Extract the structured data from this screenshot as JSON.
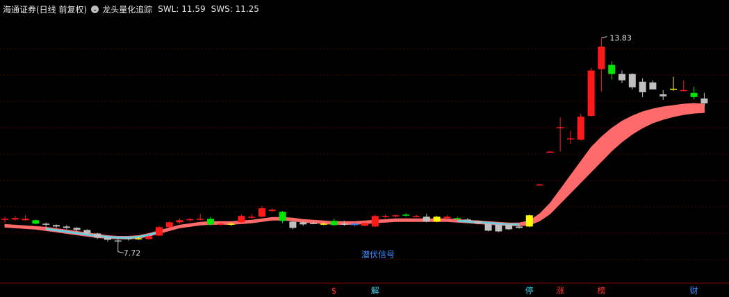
{
  "header": {
    "title": "海通证券(日线 前复权)",
    "indicator_name": "龙头量化追踪",
    "swl_label": "SWL: 11.59",
    "sws_label": "SWS: 11.25",
    "ind_icon": "chevron-down-icon"
  },
  "colors": {
    "background": "#000000",
    "grid": "#5a0000",
    "up": "#ff1a1a",
    "down": "#00e600",
    "flat_gray": "#c0c0c0",
    "yellow": "#ffff00",
    "blue": "#2a7fff",
    "band": "#ff6b6b",
    "band_cool": "#66d0e0",
    "label_red": "#ff3030",
    "label_cyan": "#3ad0e8",
    "label_blue": "#3a8bff"
  },
  "chart_data": {
    "type": "candlestick",
    "ylim": [
      6.9,
      14.4
    ],
    "annotations": {
      "high": {
        "value": 13.83,
        "label": "13.83",
        "index": 58
      },
      "low": {
        "value": 7.72,
        "label": "7.72",
        "index": 11
      },
      "signal_text": "潜伏信号",
      "signal_index": 35
    },
    "bottom_labels": [
      {
        "text": "$",
        "index": 32,
        "color": "label_red"
      },
      {
        "text": "解",
        "index": 36,
        "color": "label_cyan"
      },
      {
        "text": "停",
        "index": 51,
        "color": "label_cyan"
      },
      {
        "text": "涨",
        "index": 54,
        "color": "label_red"
      },
      {
        "text": "榜",
        "index": 58,
        "color": "label_red"
      },
      {
        "text": "财",
        "index": 67,
        "color": "label_blue"
      }
    ],
    "candles": [
      [
        8.64,
        8.72,
        8.55,
        8.66,
        "up"
      ],
      [
        8.68,
        8.74,
        8.6,
        8.64,
        "up"
      ],
      [
        8.66,
        8.76,
        8.6,
        8.62,
        "up"
      ],
      [
        8.62,
        8.64,
        8.5,
        8.52,
        "down"
      ],
      [
        8.52,
        8.55,
        8.42,
        8.5,
        "gray"
      ],
      [
        8.48,
        8.5,
        8.4,
        8.44,
        "gray"
      ],
      [
        8.44,
        8.48,
        8.36,
        8.4,
        "gray"
      ],
      [
        8.4,
        8.42,
        8.3,
        8.34,
        "gray"
      ],
      [
        8.34,
        8.36,
        8.2,
        8.24,
        "gray"
      ],
      [
        8.24,
        8.26,
        8.08,
        8.12,
        "gray"
      ],
      [
        8.12,
        8.18,
        8.0,
        8.06,
        "gray"
      ],
      [
        8.02,
        8.08,
        7.72,
        8.04,
        "gray"
      ],
      [
        8.08,
        8.12,
        8.04,
        8.1,
        "gray"
      ],
      [
        8.1,
        8.14,
        8.06,
        8.08,
        "yellow"
      ],
      [
        8.08,
        8.2,
        8.06,
        8.16,
        "up"
      ],
      [
        8.18,
        8.46,
        8.16,
        8.42,
        "up"
      ],
      [
        8.42,
        8.6,
        8.4,
        8.56,
        "up"
      ],
      [
        8.56,
        8.66,
        8.52,
        8.62,
        "up"
      ],
      [
        8.62,
        8.68,
        8.58,
        8.65,
        "up"
      ],
      [
        8.66,
        8.8,
        8.62,
        8.66,
        "up"
      ],
      [
        8.66,
        8.72,
        8.46,
        8.5,
        "down"
      ],
      [
        8.52,
        8.56,
        8.46,
        8.5,
        "up"
      ],
      [
        8.5,
        8.56,
        8.46,
        8.52,
        "yellow"
      ],
      [
        8.56,
        8.78,
        8.54,
        8.74,
        "up"
      ],
      [
        8.72,
        8.8,
        8.66,
        8.7,
        "up"
      ],
      [
        8.72,
        9.02,
        8.7,
        8.96,
        "up"
      ],
      [
        8.92,
        8.96,
        8.86,
        8.88,
        "up"
      ],
      [
        8.86,
        8.88,
        8.54,
        8.6,
        "down"
      ],
      [
        8.58,
        8.6,
        8.36,
        8.4,
        "gray"
      ],
      [
        8.5,
        8.6,
        8.46,
        8.56,
        "gray"
      ],
      [
        8.54,
        8.58,
        8.5,
        8.54,
        "gray"
      ],
      [
        8.52,
        8.56,
        8.48,
        8.5,
        "yellow"
      ],
      [
        8.48,
        8.66,
        8.46,
        8.6,
        "down"
      ],
      [
        8.52,
        8.6,
        8.46,
        8.52,
        "gray"
      ],
      [
        8.48,
        8.54,
        8.44,
        8.52,
        "blue"
      ],
      [
        8.46,
        8.56,
        8.44,
        8.54,
        "up"
      ],
      [
        8.44,
        8.78,
        8.42,
        8.74,
        "up"
      ],
      [
        8.72,
        8.78,
        8.68,
        8.74,
        "up"
      ],
      [
        8.74,
        8.78,
        8.7,
        8.76,
        "up"
      ],
      [
        8.78,
        8.82,
        8.72,
        8.76,
        "down"
      ],
      [
        8.74,
        8.78,
        8.7,
        8.72,
        "up"
      ],
      [
        8.72,
        8.8,
        8.56,
        8.58,
        "gray"
      ],
      [
        8.58,
        8.74,
        8.56,
        8.72,
        "yellow"
      ],
      [
        8.72,
        8.76,
        8.64,
        8.68,
        "up"
      ],
      [
        8.68,
        8.72,
        8.62,
        8.66,
        "down"
      ],
      [
        8.64,
        8.68,
        8.6,
        8.62,
        "gray"
      ],
      [
        8.6,
        8.62,
        8.5,
        8.52,
        "gray"
      ],
      [
        8.52,
        8.56,
        8.3,
        8.32,
        "gray"
      ],
      [
        8.3,
        8.52,
        8.28,
        8.5,
        "gray"
      ],
      [
        8.5,
        8.52,
        8.34,
        8.36,
        "gray"
      ],
      [
        8.4,
        8.48,
        8.38,
        8.44,
        "gray"
      ],
      [
        8.44,
        8.78,
        8.42,
        8.76,
        "yellow"
      ],
      [
        9.64,
        9.66,
        9.62,
        9.64,
        "up"
      ],
      [
        10.58,
        10.6,
        10.56,
        10.58,
        "up"
      ],
      [
        11.28,
        11.56,
        10.58,
        11.28,
        "up"
      ],
      [
        10.96,
        11.18,
        10.8,
        10.96,
        "up"
      ],
      [
        10.92,
        11.66,
        10.9,
        11.58,
        "up"
      ],
      [
        11.6,
        12.98,
        11.58,
        12.9,
        "up"
      ],
      [
        12.94,
        13.83,
        12.3,
        13.58,
        "up"
      ],
      [
        13.06,
        13.16,
        12.64,
        12.8,
        "down"
      ],
      [
        12.8,
        12.9,
        12.54,
        12.62,
        "gray"
      ],
      [
        12.8,
        12.82,
        12.36,
        12.42,
        "gray"
      ],
      [
        12.58,
        12.68,
        12.14,
        12.28,
        "gray"
      ],
      [
        12.56,
        12.62,
        12.36,
        12.36,
        "gray"
      ],
      [
        12.22,
        12.34,
        12.06,
        12.16,
        "gray"
      ],
      [
        12.38,
        12.72,
        12.32,
        12.36,
        "yellow"
      ],
      [
        12.34,
        12.62,
        12.32,
        12.32,
        "up"
      ],
      [
        12.26,
        12.44,
        12.08,
        12.14,
        "down"
      ],
      [
        12.1,
        12.26,
        11.88,
        11.96,
        "gray"
      ]
    ],
    "band_upper": [
      8.5,
      8.48,
      8.46,
      8.44,
      8.42,
      8.38,
      8.34,
      8.3,
      8.26,
      8.22,
      8.18,
      8.16,
      8.16,
      8.18,
      8.24,
      8.32,
      8.4,
      8.48,
      8.52,
      8.56,
      8.58,
      8.58,
      8.58,
      8.6,
      8.62,
      8.66,
      8.7,
      8.7,
      8.68,
      8.64,
      8.62,
      8.6,
      8.58,
      8.58,
      8.58,
      8.6,
      8.62,
      8.64,
      8.66,
      8.66,
      8.66,
      8.66,
      8.66,
      8.66,
      8.64,
      8.62,
      8.6,
      8.58,
      8.56,
      8.54,
      8.54,
      8.6,
      8.8,
      9.1,
      9.5,
      9.9,
      10.3,
      10.7,
      11.0,
      11.25,
      11.45,
      11.6,
      11.72,
      11.8,
      11.86,
      11.9,
      11.94,
      11.96,
      11.94
    ],
    "band_lower": [
      8.42,
      8.4,
      8.38,
      8.36,
      8.32,
      8.28,
      8.24,
      8.2,
      8.16,
      8.12,
      8.1,
      8.08,
      8.08,
      8.1,
      8.16,
      8.24,
      8.32,
      8.4,
      8.44,
      8.48,
      8.5,
      8.5,
      8.5,
      8.52,
      8.54,
      8.58,
      8.62,
      8.62,
      8.6,
      8.56,
      8.54,
      8.52,
      8.5,
      8.5,
      8.5,
      8.52,
      8.54,
      8.56,
      8.58,
      8.58,
      8.58,
      8.58,
      8.58,
      8.58,
      8.56,
      8.54,
      8.52,
      8.5,
      8.48,
      8.46,
      8.46,
      8.48,
      8.6,
      8.8,
      9.1,
      9.4,
      9.7,
      10.0,
      10.3,
      10.6,
      10.86,
      11.08,
      11.26,
      11.4,
      11.5,
      11.58,
      11.64,
      11.68,
      11.7
    ]
  }
}
